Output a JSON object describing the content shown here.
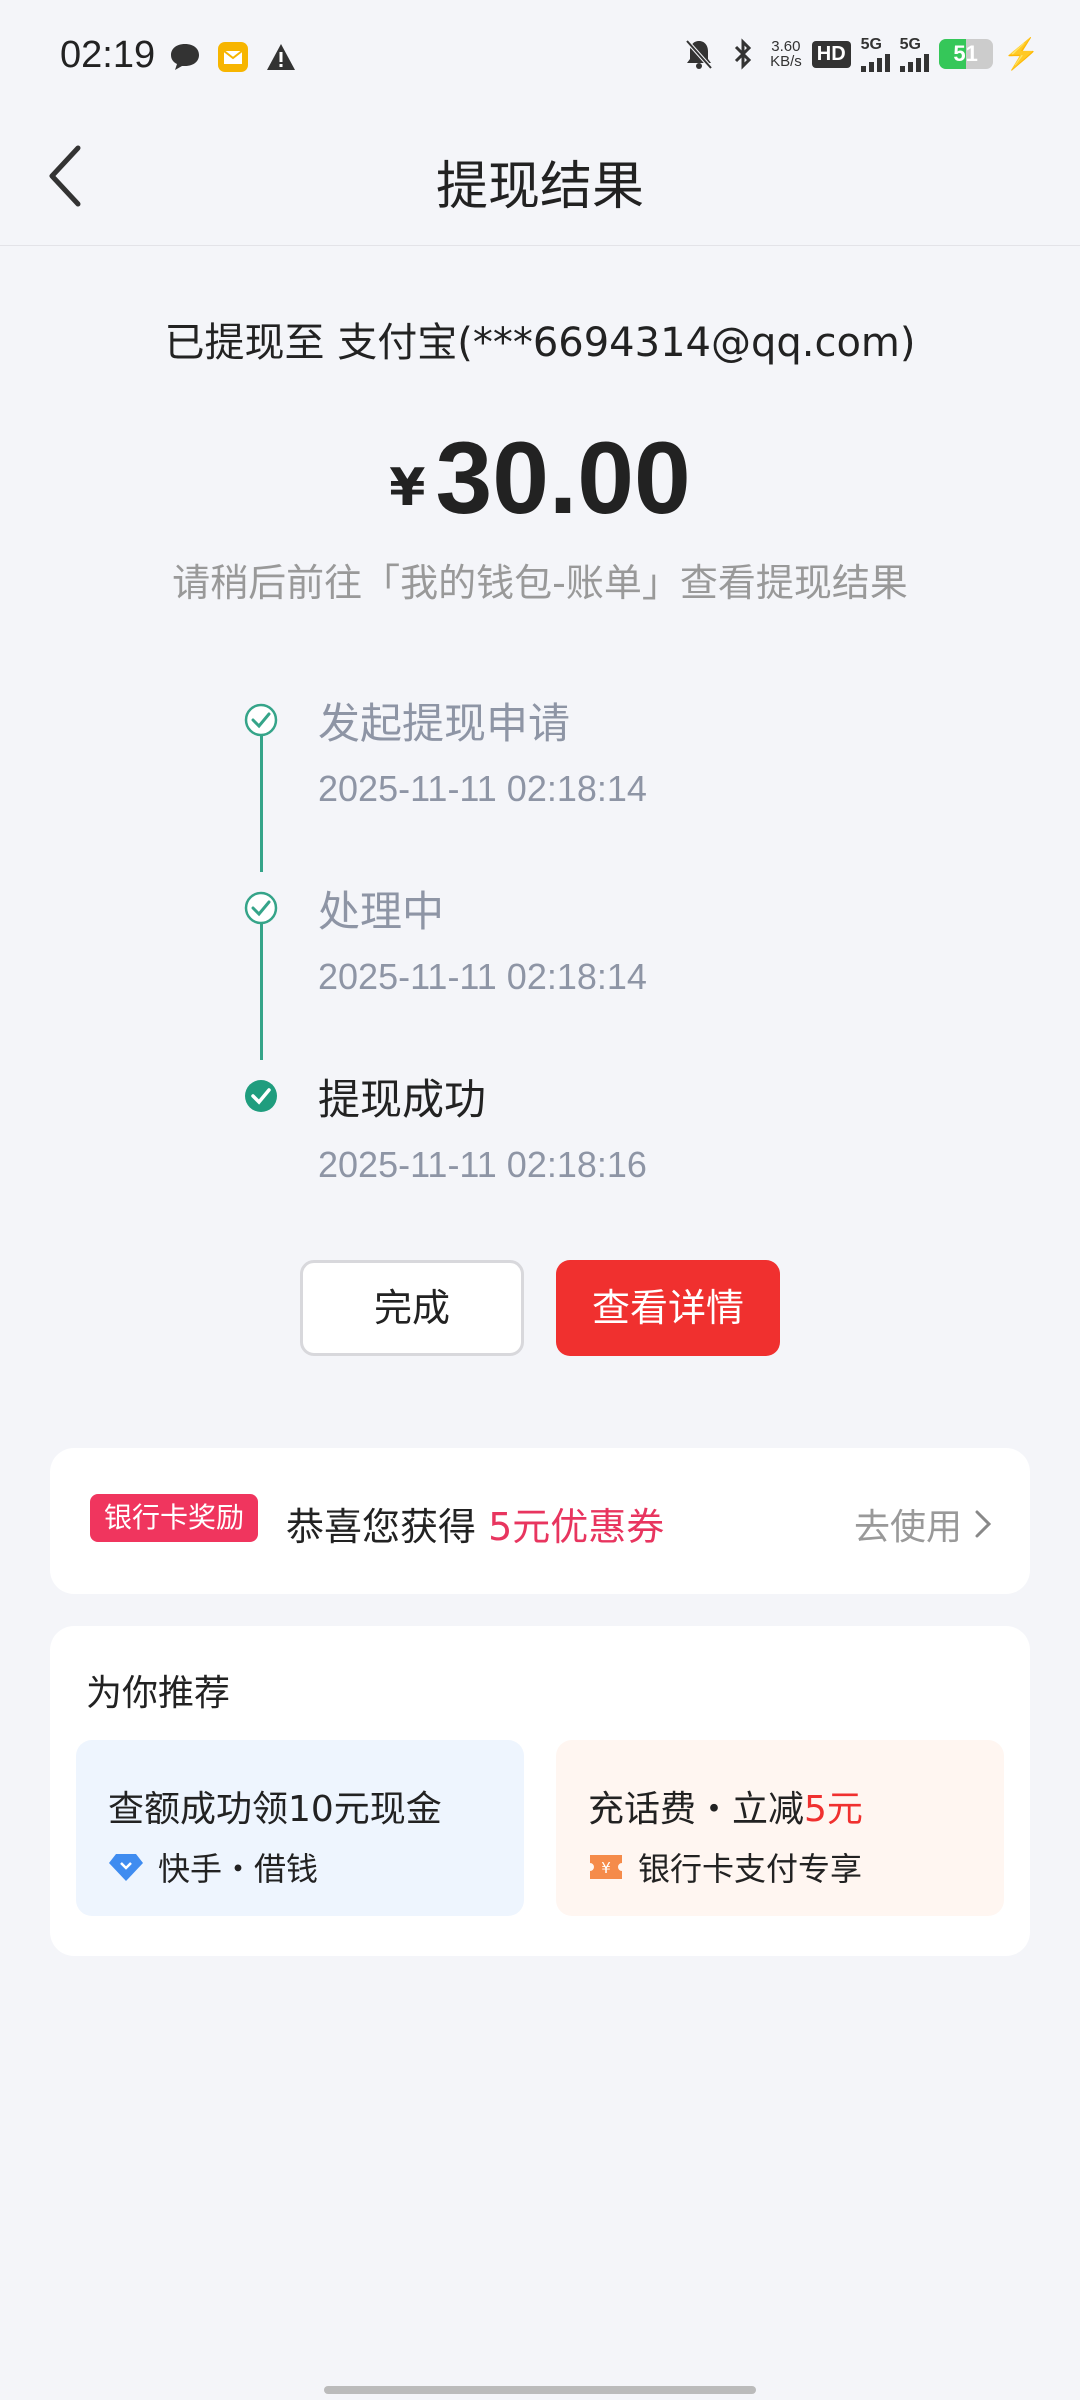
{
  "status_bar": {
    "time": "02:19",
    "net_speed_value": "3.60",
    "net_speed_unit": "KB/s",
    "hd_badge": "HD",
    "sim1_label": "5G",
    "sim2_label": "5G",
    "battery_level": "51",
    "battery_fraction": 0.51
  },
  "nav": {
    "title": "提现结果"
  },
  "result": {
    "destination": "已提现至 支付宝(***6694314@qq.com)",
    "currency_symbol": "¥",
    "amount": "30.00",
    "hint": "请稍后前往「我的钱包-账单」查看提现结果"
  },
  "timeline": [
    {
      "label": "发起提现申请",
      "time": "2025-11-11 02:18:14",
      "status": "done"
    },
    {
      "label": "处理中",
      "time": "2025-11-11 02:18:14",
      "status": "done"
    },
    {
      "label": "提现成功",
      "time": "2025-11-11 02:18:16",
      "status": "current"
    }
  ],
  "buttons": {
    "done": "完成",
    "detail": "查看详情"
  },
  "reward": {
    "tag": "银行卡奖励",
    "text_prefix": "恭喜您获得 ",
    "text_highlight": "5元优惠券",
    "action": "去使用"
  },
  "recommend": {
    "title": "为你推荐",
    "items": [
      {
        "main": "查额成功领10元现金",
        "sub": "快手・借钱"
      },
      {
        "main_prefix": "充话费・立减",
        "main_highlight": "5元",
        "sub": "银行卡支付专享"
      }
    ]
  },
  "colors": {
    "accent_red": "#f0302f",
    "timeline_green": "#35a489",
    "tag_pink": "#f0355e",
    "background": "#f4f5f9"
  }
}
